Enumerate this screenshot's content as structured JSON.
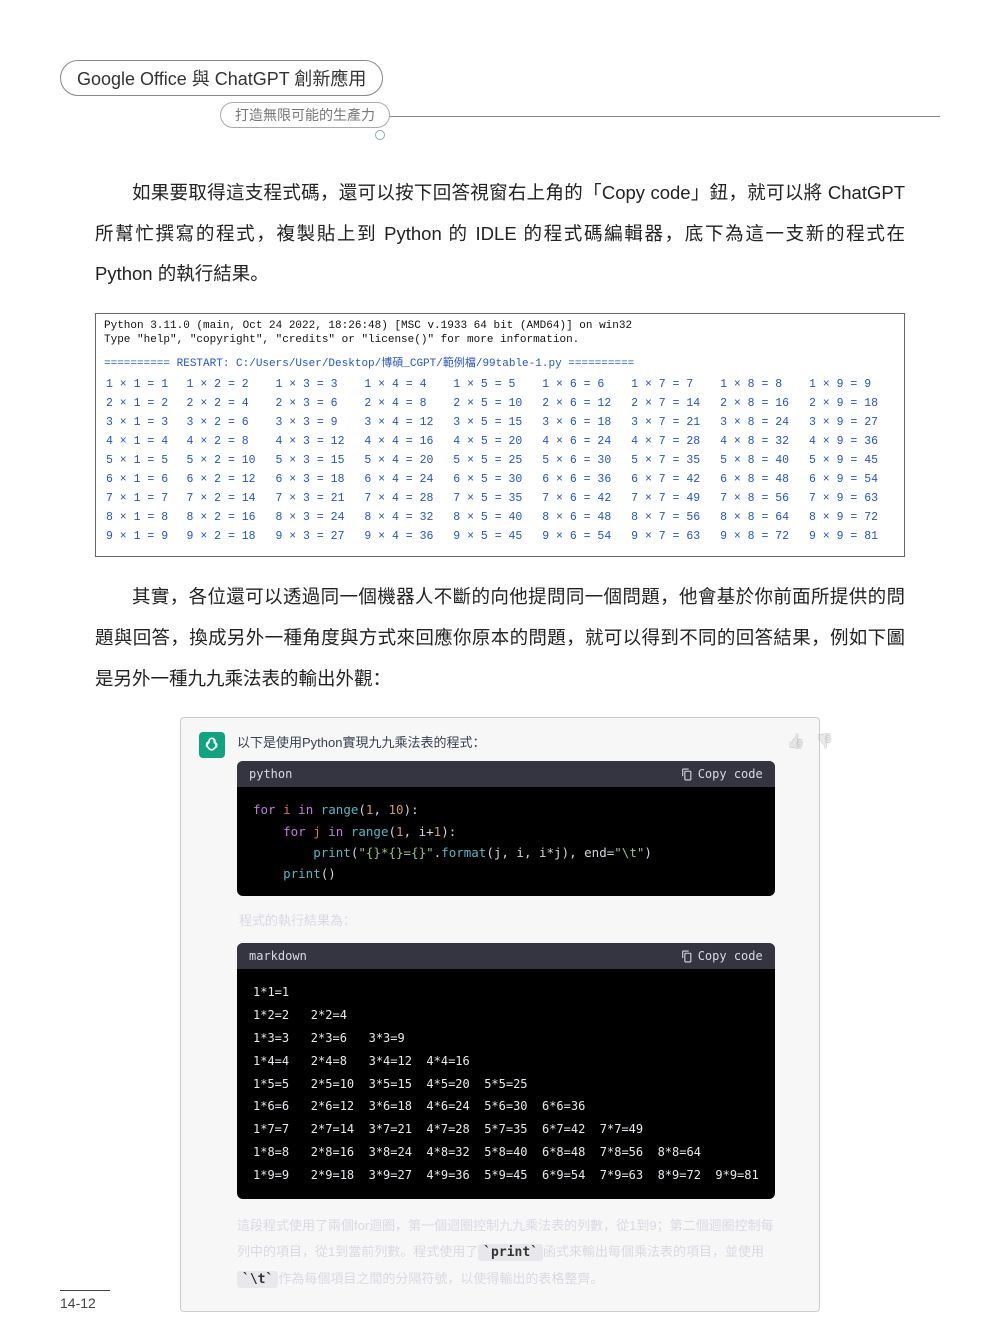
{
  "header": {
    "title": "Google Office 與 ChatGPT 創新應用",
    "subtitle": "打造無限可能的生產力"
  },
  "para1": "如果要取得這支程式碼，還可以按下回答視窗右上角的「Copy code」鈕，就可以將 ChatGPT 所幫忙撰寫的程式，複製貼上到 Python 的 IDLE 的程式碼編輯器，底下為這一支新的程式在 Python 的執行結果。",
  "idle": {
    "line1": "Python 3.11.0 (main, Oct 24 2022, 18:26:48) [MSC v.1933 64 bit (AMD64)] on win32",
    "line2": "Type \"help\", \"copyright\", \"credits\" or \"license()\" for more information.",
    "restart": "========== RESTART: C:/Users/User/Desktop/博碩_CGPT/範例檔/99table-1.py ==========",
    "rows": [
      [
        "1 × 1 = 1",
        "1 × 2 = 2",
        "1 × 3 = 3",
        "1 × 4 = 4",
        "1 × 5 = 5",
        "1 × 6 = 6",
        "1 × 7 = 7",
        "1 × 8 = 8",
        "1 × 9 = 9"
      ],
      [
        "2 × 1 = 2",
        "2 × 2 = 4",
        "2 × 3 = 6",
        "2 × 4 = 8",
        "2 × 5 = 10",
        "2 × 6 = 12",
        "2 × 7 = 14",
        "2 × 8 = 16",
        "2 × 9 = 18"
      ],
      [
        "3 × 1 = 3",
        "3 × 2 = 6",
        "3 × 3 = 9",
        "3 × 4 = 12",
        "3 × 5 = 15",
        "3 × 6 = 18",
        "3 × 7 = 21",
        "3 × 8 = 24",
        "3 × 9 = 27"
      ],
      [
        "4 × 1 = 4",
        "4 × 2 = 8",
        "4 × 3 = 12",
        "4 × 4 = 16",
        "4 × 5 = 20",
        "4 × 6 = 24",
        "4 × 7 = 28",
        "4 × 8 = 32",
        "4 × 9 = 36"
      ],
      [
        "5 × 1 = 5",
        "5 × 2 = 10",
        "5 × 3 = 15",
        "5 × 4 = 20",
        "5 × 5 = 25",
        "5 × 6 = 30",
        "5 × 7 = 35",
        "5 × 8 = 40",
        "5 × 9 = 45"
      ],
      [
        "6 × 1 = 6",
        "6 × 2 = 12",
        "6 × 3 = 18",
        "6 × 4 = 24",
        "6 × 5 = 30",
        "6 × 6 = 36",
        "6 × 7 = 42",
        "6 × 8 = 48",
        "6 × 9 = 54"
      ],
      [
        "7 × 1 = 7",
        "7 × 2 = 14",
        "7 × 3 = 21",
        "7 × 4 = 28",
        "7 × 5 = 35",
        "7 × 6 = 42",
        "7 × 7 = 49",
        "7 × 8 = 56",
        "7 × 9 = 63"
      ],
      [
        "8 × 1 = 8",
        "8 × 2 = 16",
        "8 × 3 = 24",
        "8 × 4 = 32",
        "8 × 5 = 40",
        "8 × 6 = 48",
        "8 × 7 = 56",
        "8 × 8 = 64",
        "8 × 9 = 72"
      ],
      [
        "9 × 1 = 9",
        "9 × 2 = 18",
        "9 × 3 = 27",
        "9 × 4 = 36",
        "9 × 5 = 45",
        "9 × 6 = 54",
        "9 × 7 = 63",
        "9 × 8 = 72",
        "9 × 9 = 81"
      ]
    ]
  },
  "para2": "其實，各位還可以透過同一個機器人不斷的向他提問同一個問題，他會基於你前面所提供的問題與回答，換成另外一種角度與方式來回應你原本的問題，就可以得到不同的回答結果，例如下圖是另外一種九九乘法表的輸出外觀：",
  "chat": {
    "lead": "以下是使用Python實現九九乘法表的程式：",
    "code_lang": "python",
    "copy_label": "Copy code",
    "code_lines": [
      {
        "t": "for ",
        "c": "kw"
      },
      {
        "t": "i ",
        "c": "var"
      },
      {
        "t": "in ",
        "c": "kw"
      },
      {
        "t": "range",
        "c": "fn"
      },
      {
        "t": "(",
        "c": "op"
      },
      {
        "t": "1",
        "c": "num"
      },
      {
        "t": ", ",
        "c": "op"
      },
      {
        "t": "10",
        "c": "num"
      },
      {
        "t": "):",
        "c": "op"
      },
      {
        "nl": 1
      },
      {
        "t": "    for ",
        "c": "kw"
      },
      {
        "t": "j ",
        "c": "var"
      },
      {
        "t": "in ",
        "c": "kw"
      },
      {
        "t": "range",
        "c": "fn"
      },
      {
        "t": "(",
        "c": "op"
      },
      {
        "t": "1",
        "c": "num"
      },
      {
        "t": ", i+",
        "c": "op"
      },
      {
        "t": "1",
        "c": "num"
      },
      {
        "t": "):",
        "c": "op"
      },
      {
        "nl": 1
      },
      {
        "t": "        print",
        "c": "fn"
      },
      {
        "t": "(",
        "c": "op"
      },
      {
        "t": "\"{}*{}={}\"",
        "c": "str"
      },
      {
        "t": ".",
        "c": "op"
      },
      {
        "t": "format",
        "c": "fn"
      },
      {
        "t": "(j, i, i*j), end=",
        "c": "op"
      },
      {
        "t": "\"\\t\"",
        "c": "str"
      },
      {
        "t": ")",
        "c": "op"
      },
      {
        "nl": 1
      },
      {
        "t": "    print",
        "c": "fn"
      },
      {
        "t": "()",
        "c": "op"
      }
    ],
    "exec_label": "程式的執行結果為：",
    "md_lang": "markdown",
    "md_rows": [
      "1*1=1",
      "1*2=2   2*2=4",
      "1*3=3   2*3=6   3*3=9",
      "1*4=4   2*4=8   3*4=12  4*4=16",
      "1*5=5   2*5=10  3*5=15  4*5=20  5*5=25",
      "1*6=6   2*6=12  3*6=18  4*6=24  5*6=30  6*6=36",
      "1*7=7   2*7=14  3*7=21  4*7=28  5*7=35  6*7=42  7*7=49",
      "1*8=8   2*8=16  3*8=24  4*8=32  5*8=40  6*8=48  7*8=56  8*8=64",
      "1*9=9   2*9=18  3*9=27  4*9=36  5*9=45  6*9=54  7*9=63  8*9=72  9*9=81"
    ],
    "explain_parts": [
      {
        "t": "這段程式使用了兩個for迴圈，第一個迴圈控制九九乘法表的列數，從1到9；第二個迴圈控制每列中的項目，從1到當前列數。程式使用了"
      },
      {
        "code": "`print`"
      },
      {
        "t": "函式來輸出每個乘法表的項目，並使用"
      },
      {
        "code": "`\\t`"
      },
      {
        "t": "作為每個項目之間的分隔符號，以使得輸出的表格整齊。"
      }
    ]
  },
  "page_number": "14-12",
  "icons": {
    "thumbs_up": "👍",
    "thumbs_down": "👎"
  }
}
